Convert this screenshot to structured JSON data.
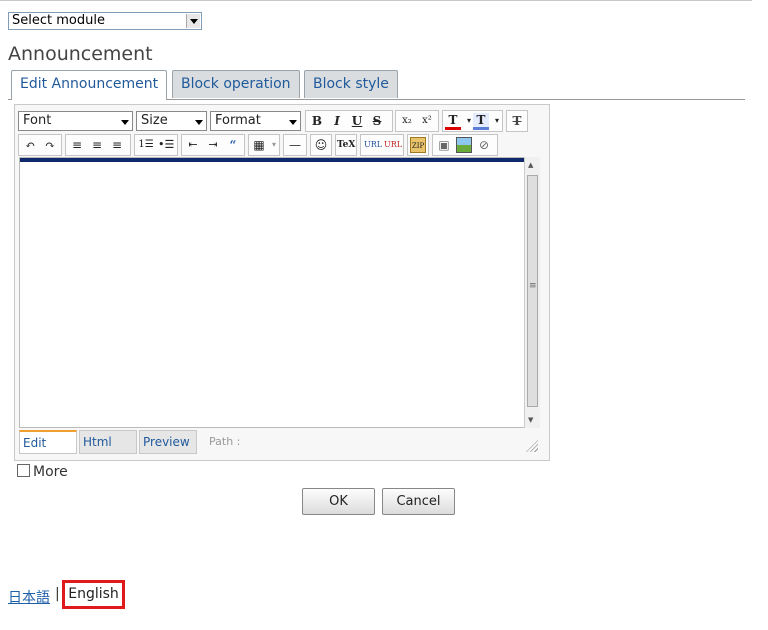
{
  "module_select": {
    "value": "Select module"
  },
  "page_title": "Announcement",
  "tabs": [
    {
      "label": "Edit Announcement",
      "active": true
    },
    {
      "label": "Block operation",
      "active": false
    },
    {
      "label": "Block style",
      "active": false
    }
  ],
  "toolbar": {
    "font": "Font",
    "size": "Size",
    "format": "Format",
    "icons": [
      "bold-icon",
      "italic-icon",
      "underline-icon",
      "strikethrough-icon",
      "subscript-icon",
      "superscript-icon",
      "text-color-icon",
      "highlight-color-icon",
      "clear-format-icon",
      "undo-icon",
      "redo-icon",
      "align-left-icon",
      "align-center-icon",
      "align-right-icon",
      "ordered-list-icon",
      "unordered-list-icon",
      "outdent-icon",
      "indent-icon",
      "blockquote-icon",
      "table-icon",
      "horizontal-rule-icon",
      "emoticon-icon",
      "tex-icon",
      "insert-link-icon",
      "remove-link-icon",
      "zip-icon",
      "video-icon",
      "image-icon",
      "attachment-icon"
    ]
  },
  "editor": {
    "modes": [
      "Edit",
      "Html",
      "Preview"
    ],
    "path_label": "Path :"
  },
  "more_label": "More",
  "buttons": {
    "ok": "OK",
    "cancel": "Cancel"
  },
  "languages": {
    "japanese": "日本語",
    "separator": "|",
    "english": "English"
  },
  "colors": {
    "tab_text": "#215a9b",
    "highlight_border": "#e0191b",
    "editor_bar": "#0e2a6b"
  }
}
